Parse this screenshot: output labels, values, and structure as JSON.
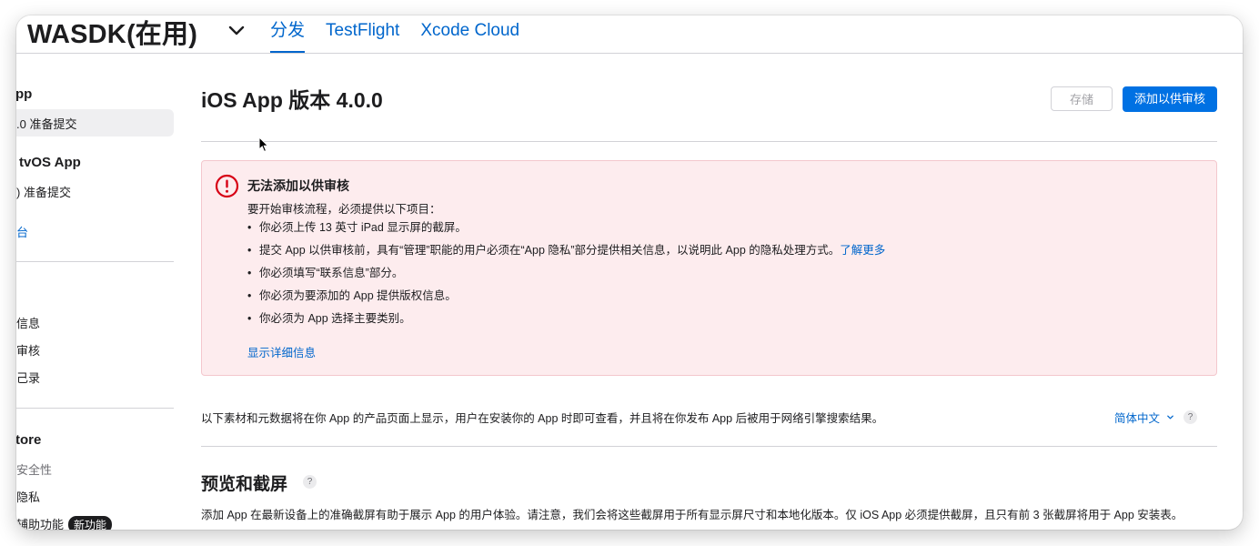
{
  "header": {
    "app_title": "WASDK(在用)",
    "tabs": [
      "分发",
      "TestFlight",
      "Xcode Cloud"
    ]
  },
  "sidebar": {
    "ios_heading": "pp",
    "ios_version_item": ".0 准备提交",
    "tvos_heading": "tvOS App",
    "tvos_version_item": ") 准备提交",
    "platform_link": "台",
    "general_items": [
      "信息",
      "审核",
      "己录"
    ],
    "store_heading": "tore",
    "store_items": [
      "安全性",
      "隐私",
      "辅助功能"
    ],
    "new_badge": "新功能"
  },
  "main": {
    "version_title": "iOS App 版本 4.0.0",
    "save_button": "存储",
    "submit_button": "添加以供审核",
    "error": {
      "title": "无法添加以供审核",
      "intro": "要开始审核流程，必须提供以下项目：",
      "items": [
        "你必须上传 13 英寸 iPad 显示屏的截屏。",
        "提交 App 以供审核前，具有“管理”职能的用户必须在“App 隐私”部分提供相关信息，以说明此 App 的隐私处理方式。",
        "你必须填写“联系信息”部分。",
        "你必须为要添加的 App 提供版权信息。",
        "你必须为 App 选择主要类别。"
      ],
      "learn_more": "了解更多",
      "show_details": "显示详细信息"
    },
    "description": "以下素材和元数据将在你 App 的产品页面上显示，用户在安装你的 App 时即可查看，并且将在你发布 App 后被用于网络引擎搜索结果。",
    "language_select": "简体中文",
    "help_mark": "?",
    "preview_section": {
      "title": "预览和截屏",
      "description": "添加 App 在最新设备上的准确截屏有助于展示 App 的用户体验。请注意，我们会将这些截屏用于所有显示屏尺寸和本地化版本。仅 iOS App 必须提供截屏，且只有前 3 张截屏将用于 App 安装表。"
    }
  },
  "colors": {
    "accent": "#0066cc",
    "button_primary": "#0071e3",
    "error_bg": "#fdecee",
    "error_icon": "#d70015"
  },
  "icons": [
    "chevron-down-icon",
    "exclamation-circle-icon",
    "help-icon",
    "mouse-cursor-icon"
  ]
}
